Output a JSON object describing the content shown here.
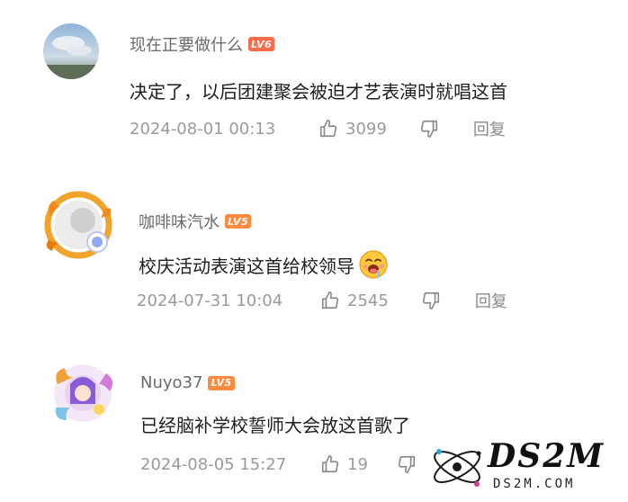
{
  "comments": [
    {
      "username": "现在正要做什么",
      "level": "LV6",
      "level_color": "#ff6b4a",
      "text": "决定了，以后团建聚会被迫才艺表演时就唱这首",
      "date": "2024-08-01 00:13",
      "likes": "3099",
      "reply_label": "回复"
    },
    {
      "username": "咖啡味汽水",
      "level": "LV5",
      "level_color": "#ff8a3d",
      "text": "校庆活动表演这首给校领导",
      "date": "2024-07-31 10:04",
      "likes": "2545",
      "reply_label": "回复"
    },
    {
      "username": "Nuyo37",
      "level": "LV5",
      "level_color": "#ff8a3d",
      "text": "已经脑补学校誓师大会放这首歌了",
      "date": "2024-08-05 15:27",
      "likes": "19",
      "reply_label": "回复"
    }
  ],
  "watermark": {
    "logo_text": "DS2M",
    "site_text": "DS2M.COM"
  },
  "icons": {
    "like": "thumbs-up-icon",
    "dislike": "thumbs-down-icon",
    "emoji": "drooling-face-emoji-icon"
  }
}
